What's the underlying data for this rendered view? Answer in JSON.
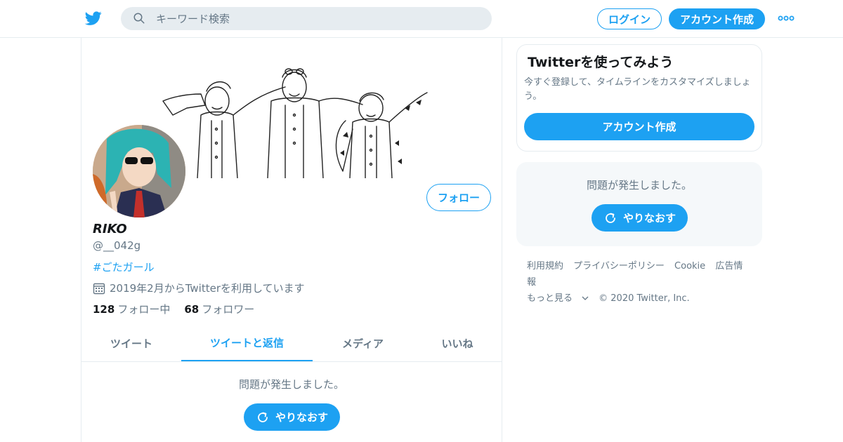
{
  "header": {
    "logo_icon": "twitter-bird-icon",
    "search_placeholder": "キーワード検索",
    "login_label": "ログイン",
    "signup_label": "アカウント作成",
    "more_icon": "more-dots-icon",
    "accent_color": "#1da1f2"
  },
  "profile": {
    "name": "RIKO",
    "handle": "@__042g",
    "bio_hashtag": "#ごたガール",
    "joined": "2019年2月からTwitterを利用しています",
    "following_count": "128",
    "following_label": "フォロー中",
    "followers_count": "68",
    "followers_label": "フォロワー",
    "follow_button": "フォロー"
  },
  "tabs": [
    {
      "label": "ツイート"
    },
    {
      "label": "ツイートと返信"
    },
    {
      "label": "メディア"
    },
    {
      "label": "いいね"
    }
  ],
  "timeline": {
    "error_text": "問題が発生しました。",
    "retry_label": "やりなおす"
  },
  "sidebar": {
    "signup_card": {
      "title": "Twitterを使ってみよう",
      "description": "今すぐ登録して、タイムラインをカスタマイズしましょう。",
      "button": "アカウント作成"
    },
    "error_box": {
      "text": "問題が発生しました。",
      "retry_label": "やりなおす"
    },
    "footer": {
      "links": [
        "利用規約",
        "プライバシーポリシー",
        "Cookie",
        "広告情報"
      ],
      "more": "もっと見る",
      "copyright": "© 2020 Twitter, Inc."
    }
  }
}
